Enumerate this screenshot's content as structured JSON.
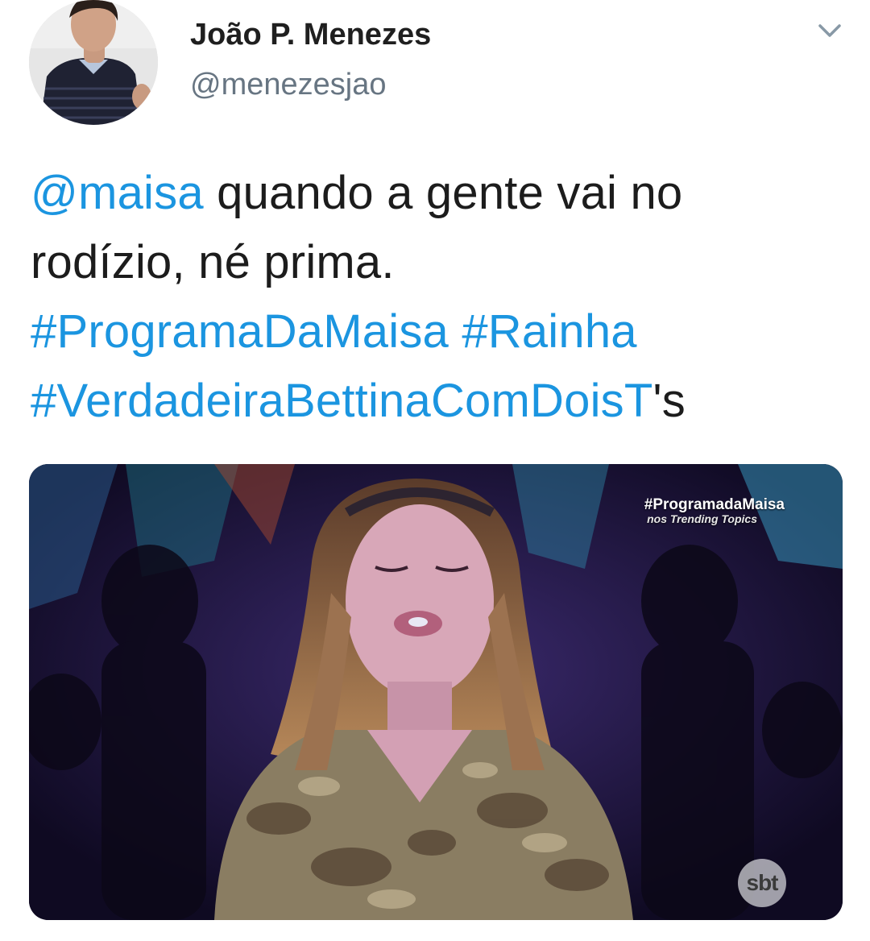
{
  "author": {
    "display_name": "João P. Menezes",
    "handle": "@menezesjao",
    "avatar_icon": "profile-photo"
  },
  "menu": {
    "icon": "chevron-down-icon"
  },
  "tweet": {
    "mention": "@maisa",
    "text_line1_rest": " quando a gente vai no",
    "text_line2": "rodízio, né prima.",
    "hashtag1": "#ProgramaDaMaisa",
    "hashtag2": "#Rainha",
    "hashtag3": "#VerdadeiraBettinaComDoisT",
    "hashtag3_suffix": "'s"
  },
  "media": {
    "overlay_tag": "#ProgramadaMaisa",
    "overlay_sub": "nos Trending Topics",
    "network_logo": "sbt"
  },
  "colors": {
    "link": "#1b95e0",
    "text": "#1c1c1c",
    "handle": "#677582"
  }
}
